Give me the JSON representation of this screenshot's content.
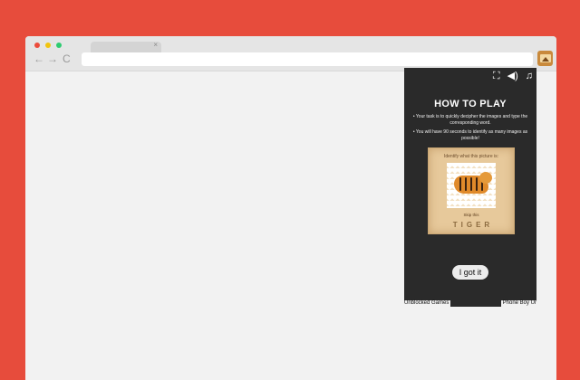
{
  "browser": {
    "nav": {
      "back": "←",
      "forward": "→",
      "reload": "C"
    },
    "tab": {
      "close": "×"
    },
    "extension_icon": "picture-frame-icon"
  },
  "popup": {
    "icons": {
      "fullscreen": "⛶",
      "sound": "◀)",
      "music": "♫"
    },
    "title": "HOW TO PLAY",
    "rules": [
      "• Your task is to quickly decipher the images and type the corresponding word.",
      "• You will have 90 seconds to identify as many images as possible!"
    ],
    "example": {
      "prompt": "Identify what this picture is:",
      "skip": "Skip this",
      "answer": "TIGER"
    },
    "button_label": "I got it",
    "footer_left": "Unblocked Games",
    "footer_right": "Phone Boy Ur"
  },
  "colors": {
    "background": "#e74c3c",
    "popup": "#2a2a2a",
    "card": "#e7c99b"
  }
}
